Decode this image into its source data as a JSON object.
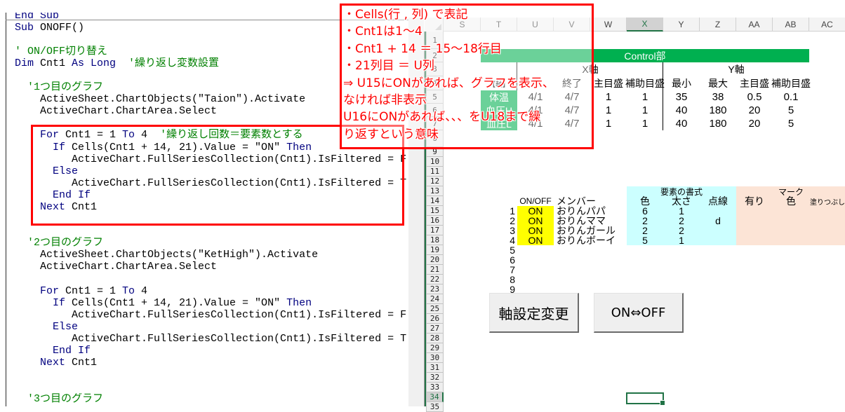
{
  "code_editor": {
    "lines": [
      [
        {
          "k": "kw",
          "t": "End Sub"
        }
      ],
      [
        {
          "k": "kw",
          "t": "Sub"
        },
        {
          "k": "tx",
          "t": " ONOFF()"
        }
      ],
      [],
      [
        {
          "k": "cm",
          "t": "' ON/OFF切り替え"
        }
      ],
      [
        {
          "k": "kw",
          "t": "Dim"
        },
        {
          "k": "tx",
          "t": " Cnt1 "
        },
        {
          "k": "kw",
          "t": "As Long"
        },
        {
          "k": "cm",
          "t": "  '繰り返し変数設置"
        }
      ],
      [],
      [
        {
          "k": "cm",
          "t": "  '1つ目のグラフ"
        }
      ],
      [
        {
          "k": "tx",
          "t": "    ActiveSheet.ChartObjects(\"Taion\").Activate"
        }
      ],
      [
        {
          "k": "tx",
          "t": "    ActiveChart.ChartArea.Select"
        }
      ],
      [],
      [
        {
          "k": "kw",
          "t": "    For"
        },
        {
          "k": "tx",
          "t": " Cnt1 = 1 "
        },
        {
          "k": "kw",
          "t": "To"
        },
        {
          "k": "tx",
          "t": " 4"
        },
        {
          "k": "cm",
          "t": "  '繰り返し回数＝要素数とする"
        }
      ],
      [
        {
          "k": "kw",
          "t": "      If"
        },
        {
          "k": "tx",
          "t": " Cells(Cnt1 + 14, 21).Value = \"ON\" "
        },
        {
          "k": "kw",
          "t": "Then"
        }
      ],
      [
        {
          "k": "tx",
          "t": "         ActiveChart.FullSeriesCollection(Cnt1).IsFiltered = F"
        }
      ],
      [
        {
          "k": "kw",
          "t": "      Else"
        }
      ],
      [
        {
          "k": "tx",
          "t": "         ActiveChart.FullSeriesCollection(Cnt1).IsFiltered = T"
        }
      ],
      [
        {
          "k": "kw",
          "t": "      End If"
        }
      ],
      [
        {
          "k": "kw",
          "t": "    Next"
        },
        {
          "k": "tx",
          "t": " Cnt1"
        }
      ],
      [],
      [],
      [
        {
          "k": "cm",
          "t": "  '2つ目のグラフ"
        }
      ],
      [
        {
          "k": "tx",
          "t": "    ActiveSheet.ChartObjects(\"KetHigh\").Activate"
        }
      ],
      [
        {
          "k": "tx",
          "t": "    ActiveChart.ChartArea.Select"
        }
      ],
      [],
      [
        {
          "k": "kw",
          "t": "    For"
        },
        {
          "k": "tx",
          "t": " Cnt1 = 1 "
        },
        {
          "k": "kw",
          "t": "To"
        },
        {
          "k": "tx",
          "t": " 4"
        }
      ],
      [
        {
          "k": "kw",
          "t": "      If"
        },
        {
          "k": "tx",
          "t": " Cells(Cnt1 + 14, 21).Value = \"ON\" "
        },
        {
          "k": "kw",
          "t": "Then"
        }
      ],
      [
        {
          "k": "tx",
          "t": "         ActiveChart.FullSeriesCollection(Cnt1).IsFiltered = F"
        }
      ],
      [
        {
          "k": "kw",
          "t": "      Else"
        }
      ],
      [
        {
          "k": "tx",
          "t": "         ActiveChart.FullSeriesCollection(Cnt1).IsFiltered = T"
        }
      ],
      [
        {
          "k": "kw",
          "t": "      End If"
        }
      ],
      [
        {
          "k": "kw",
          "t": "    Next"
        },
        {
          "k": "tx",
          "t": " Cnt1"
        }
      ],
      [],
      [],
      [
        {
          "k": "cm",
          "t": "  '3つ目のグラフ"
        }
      ]
    ],
    "colors": {
      "keyword": "#00007f",
      "comment": "#008000",
      "text": "#000000"
    }
  },
  "annotation": {
    "color": "#ff0000",
    "lines": [
      "・Cells(行 , 列) で表記",
      "・Cnt1は1～4",
      "・Cnt1 + 14 ＝ 15～18行目",
      "・21列目 ＝ U列",
      "⇒ U15にONがあれば、グラフを表示、",
      "なければ非表示",
      "U16にONがあれば、、、をU18まで繰",
      "り返すという意味"
    ]
  },
  "sheet": {
    "columns": [
      "S",
      "T",
      "U",
      "V",
      "W",
      "X",
      "Y",
      "Z",
      "AA",
      "AB",
      "AC"
    ],
    "rows": [
      1,
      2,
      3,
      4,
      5,
      6,
      7,
      8,
      9,
      10,
      11,
      12,
      13,
      14,
      15,
      16,
      17,
      18,
      19,
      20,
      21,
      22,
      23,
      24,
      25,
      26,
      27,
      28,
      29,
      30,
      31,
      32,
      33,
      34,
      35
    ],
    "selected_cell": "X34",
    "fills": [
      {
        "range": "T2:AB2",
        "color": "#00b050"
      },
      {
        "range": "T5:T7",
        "color": "#00b050"
      },
      {
        "range": "U15:U18",
        "color": "#ffff00"
      },
      {
        "range": "X13:Z18",
        "color": "#ccffff"
      },
      {
        "range": "AA13:AC18",
        "color": "#fce4d6"
      }
    ],
    "borders": [
      {
        "range": "U3:U4",
        "side": "left"
      },
      {
        "range": "Y3:Y7",
        "side": "left"
      }
    ],
    "cells": [
      {
        "ref": "T2:AB2",
        "v": "Control部",
        "fg": "#ffffff"
      },
      {
        "ref": "U3:X3",
        "v": "X軸"
      },
      {
        "ref": "Y3:AB3",
        "v": "Y軸"
      },
      {
        "ref": "T4",
        "v": "【軸】"
      },
      {
        "ref": "V4",
        "v": "終了"
      },
      {
        "ref": "W4",
        "v": "主目盛"
      },
      {
        "ref": "X4",
        "v": "補助目盛"
      },
      {
        "ref": "Y4",
        "v": "最小"
      },
      {
        "ref": "Z4",
        "v": "最大"
      },
      {
        "ref": "AA4",
        "v": "主目盛"
      },
      {
        "ref": "AB4",
        "v": "補助目盛"
      },
      {
        "ref": "T5",
        "v": "体温",
        "fg": "#ffffff"
      },
      {
        "ref": "U5",
        "v": "4/1"
      },
      {
        "ref": "V5",
        "v": "4/7"
      },
      {
        "ref": "W5",
        "v": "1"
      },
      {
        "ref": "X5",
        "v": "1"
      },
      {
        "ref": "Y5",
        "v": "35"
      },
      {
        "ref": "Z5",
        "v": "38"
      },
      {
        "ref": "AA5",
        "v": "0.5"
      },
      {
        "ref": "AB5",
        "v": "0.1"
      },
      {
        "ref": "T6",
        "v": "血圧H",
        "fg": "#ffffff"
      },
      {
        "ref": "U6",
        "v": "4/1"
      },
      {
        "ref": "V6",
        "v": "4/7"
      },
      {
        "ref": "W6",
        "v": "1"
      },
      {
        "ref": "X6",
        "v": "1"
      },
      {
        "ref": "Y6",
        "v": "40"
      },
      {
        "ref": "Z6",
        "v": "180"
      },
      {
        "ref": "AA6",
        "v": "20"
      },
      {
        "ref": "AB6",
        "v": "5"
      },
      {
        "ref": "T7",
        "v": "血圧L",
        "fg": "#ffffff"
      },
      {
        "ref": "U7",
        "v": "4/1"
      },
      {
        "ref": "V7",
        "v": "4/7"
      },
      {
        "ref": "W7",
        "v": "1"
      },
      {
        "ref": "X7",
        "v": "1"
      },
      {
        "ref": "Y7",
        "v": "40"
      },
      {
        "ref": "Z7",
        "v": "180"
      },
      {
        "ref": "AA7",
        "v": "20"
      },
      {
        "ref": "AB7",
        "v": "5"
      },
      {
        "ref": "X13:Z13",
        "v": "要素の書式"
      },
      {
        "ref": "AA13:AC13",
        "v": "マーク"
      },
      {
        "ref": "U14",
        "v": "ON/OFF"
      },
      {
        "ref": "V14",
        "v": "メンバー"
      },
      {
        "ref": "X14",
        "v": "色"
      },
      {
        "ref": "Y14",
        "v": "太さ"
      },
      {
        "ref": "Z14",
        "v": "点線"
      },
      {
        "ref": "AA14",
        "v": "有り"
      },
      {
        "ref": "AB14",
        "v": "色"
      },
      {
        "ref": "AC14",
        "v": "塗りつぶし"
      },
      {
        "ref": "T15",
        "v": "1"
      },
      {
        "ref": "U15",
        "v": "ON"
      },
      {
        "ref": "V15",
        "v": "おりんパパ"
      },
      {
        "ref": "X15",
        "v": "6"
      },
      {
        "ref": "Y15",
        "v": "1"
      },
      {
        "ref": "T16",
        "v": "2"
      },
      {
        "ref": "U16",
        "v": "ON"
      },
      {
        "ref": "V16",
        "v": "おりんママ"
      },
      {
        "ref": "X16",
        "v": "2"
      },
      {
        "ref": "Y16",
        "v": "2"
      },
      {
        "ref": "Z16",
        "v": "d"
      },
      {
        "ref": "T17",
        "v": "3"
      },
      {
        "ref": "U17",
        "v": "ON"
      },
      {
        "ref": "V17",
        "v": "おりんガール"
      },
      {
        "ref": "X17",
        "v": "2"
      },
      {
        "ref": "Y17",
        "v": "2"
      },
      {
        "ref": "T18",
        "v": "4"
      },
      {
        "ref": "U18",
        "v": "ON"
      },
      {
        "ref": "V18",
        "v": "おりんボーイ"
      },
      {
        "ref": "X18",
        "v": "5"
      },
      {
        "ref": "Y18",
        "v": "1"
      },
      {
        "ref": "T19",
        "v": "5"
      },
      {
        "ref": "T20",
        "v": "6"
      },
      {
        "ref": "T21",
        "v": "7"
      },
      {
        "ref": "T22",
        "v": "8"
      },
      {
        "ref": "T23",
        "v": "9"
      }
    ]
  },
  "buttons": [
    {
      "label": "軸設定変更"
    },
    {
      "label": "ON⇔OFF"
    }
  ]
}
